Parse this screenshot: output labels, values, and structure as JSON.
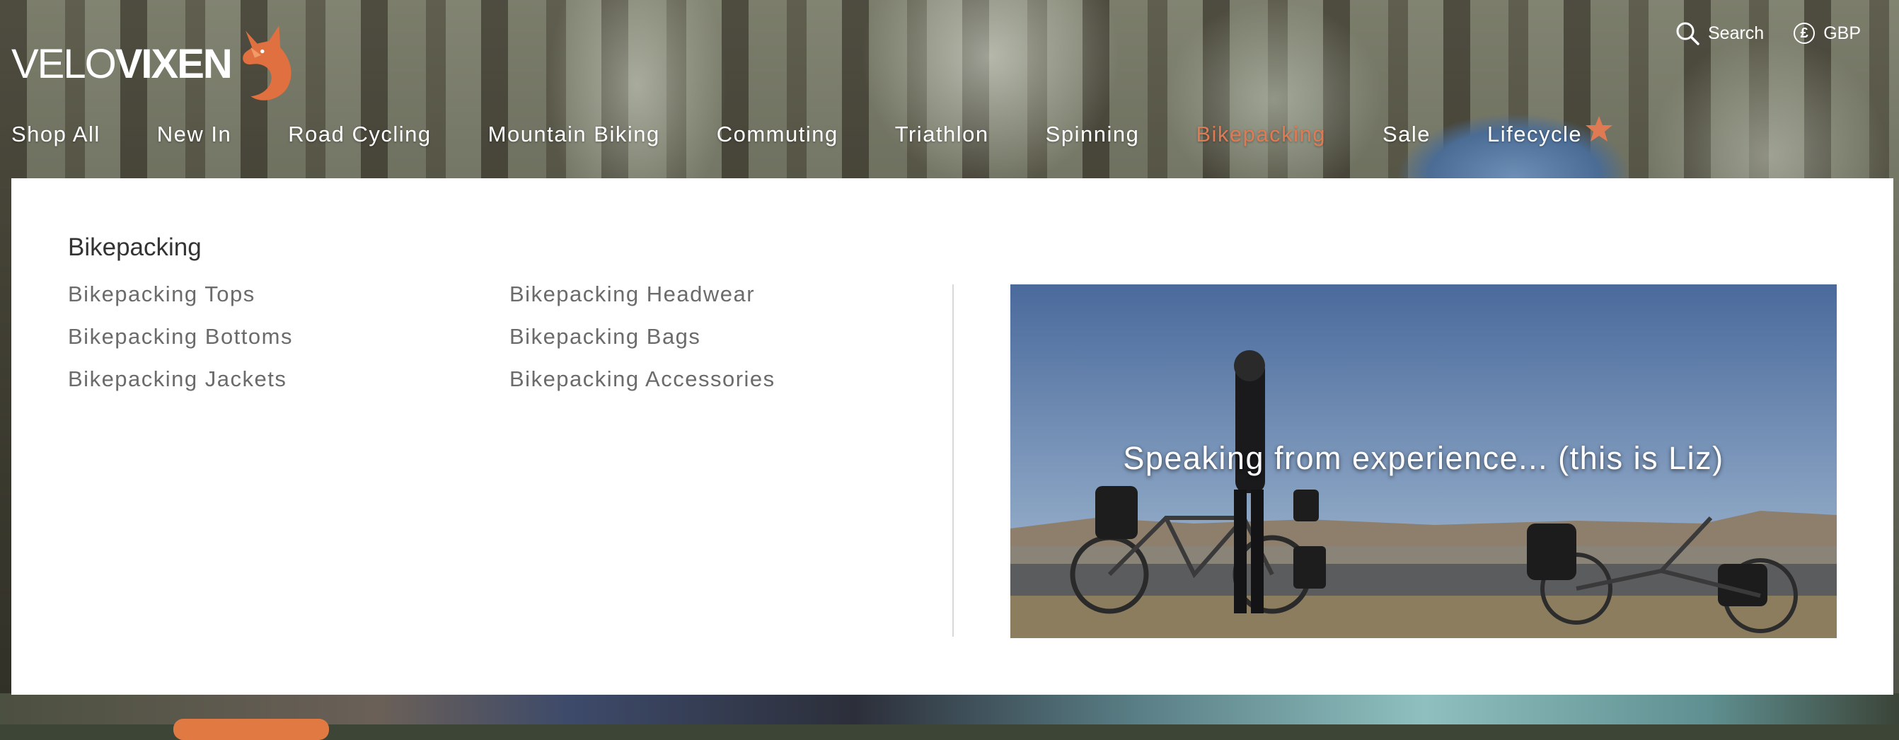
{
  "brand": {
    "logo_light": "VELO",
    "logo_bold": "VIXEN",
    "accent_color": "#e07a52"
  },
  "utility": {
    "search_label": "Search",
    "currency_label": "GBP"
  },
  "nav": {
    "items": [
      {
        "label": "Shop All"
      },
      {
        "label": "New In"
      },
      {
        "label": "Road Cycling"
      },
      {
        "label": "Mountain Biking"
      },
      {
        "label": "Commuting"
      },
      {
        "label": "Triathlon"
      },
      {
        "label": "Spinning"
      },
      {
        "label": "Bikepacking",
        "active": true
      },
      {
        "label": "Sale"
      },
      {
        "label": "Lifecycle"
      }
    ]
  },
  "dropdown": {
    "heading": "Bikepacking",
    "col1": [
      "Bikepacking Tops",
      "Bikepacking Bottoms",
      "Bikepacking Jackets"
    ],
    "col2": [
      "Bikepacking Headwear",
      "Bikepacking Bags",
      "Bikepacking Accessories"
    ],
    "promo_caption": "Speaking from experience... (this is Liz)"
  },
  "icons": {
    "search": "search-icon",
    "currency": "pound-icon",
    "fox": "fox-logo-icon",
    "star": "star-icon"
  }
}
